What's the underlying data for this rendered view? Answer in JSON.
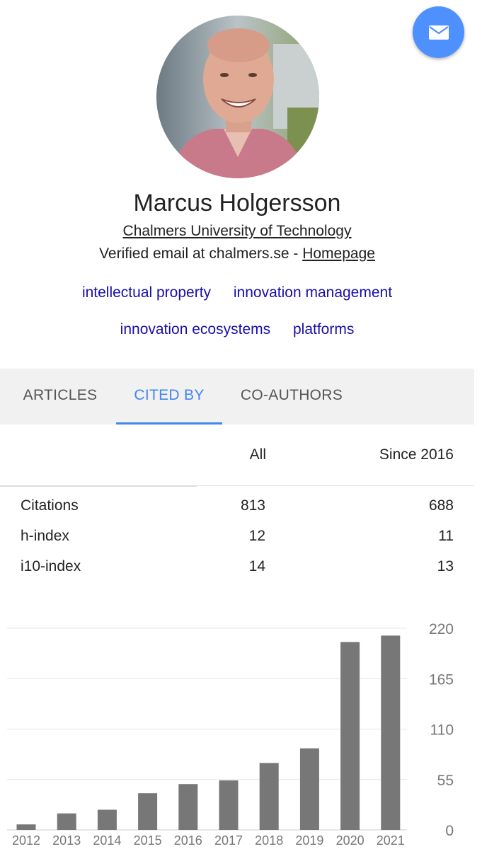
{
  "profile": {
    "name": "Marcus Holgersson",
    "affiliation": "Chalmers University of Technology",
    "email_text": "Verified email at chalmers.se - ",
    "homepage_label": "Homepage"
  },
  "interests": [
    "intellectual property",
    "innovation management",
    "innovation ecosystems",
    "platforms"
  ],
  "tabs": {
    "articles": "ARTICLES",
    "cited_by": "CITED BY",
    "co_authors": "CO-AUTHORS",
    "active": "cited_by"
  },
  "stats": {
    "header_all": "All",
    "header_since": "Since 2016",
    "rows": [
      {
        "label": "Citations",
        "all": "813",
        "since": "688"
      },
      {
        "label": "h-index",
        "all": "12",
        "since": "11"
      },
      {
        "label": "i10-index",
        "all": "14",
        "since": "13"
      }
    ]
  },
  "colors": {
    "accent": "#4285f4",
    "fab": "#4d90fe",
    "link": "#1a0dab",
    "bar": "#777777"
  },
  "chart_data": {
    "type": "bar",
    "categories": [
      "2012",
      "2013",
      "2014",
      "2015",
      "2016",
      "2017",
      "2018",
      "2019",
      "2020",
      "2021"
    ],
    "values": [
      6,
      18,
      22,
      40,
      50,
      54,
      73,
      89,
      205,
      212
    ],
    "ylim": [
      0,
      220
    ],
    "yticks": [
      "0",
      "55",
      "110",
      "165",
      "220"
    ],
    "grid": true
  }
}
